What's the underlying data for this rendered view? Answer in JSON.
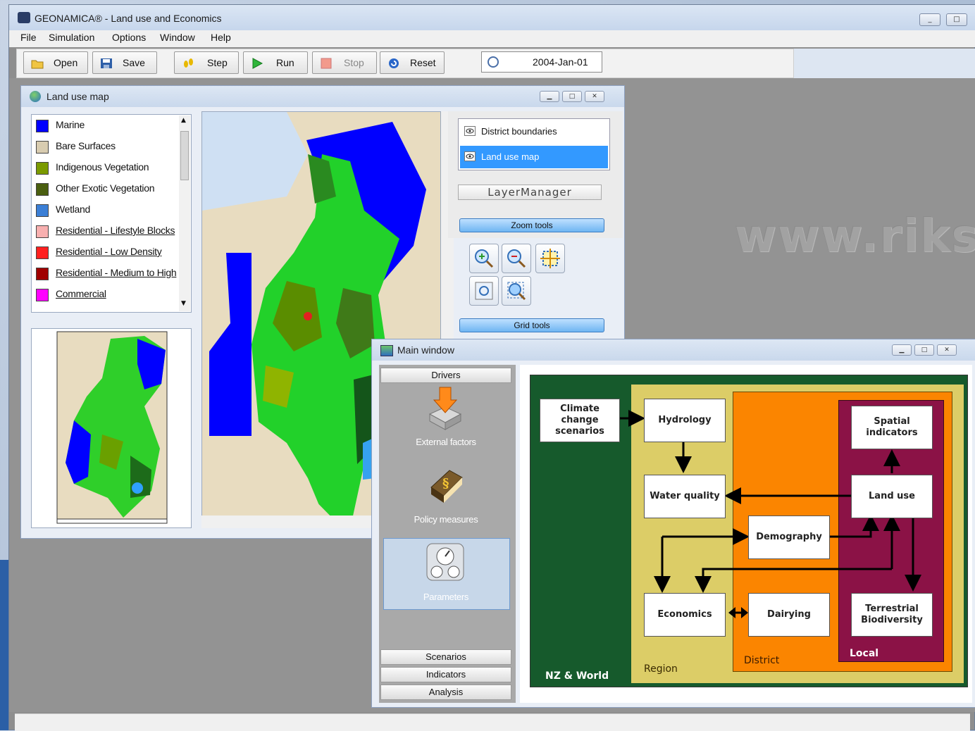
{
  "app": {
    "title": "GEONAMICA® - Land use and Economics",
    "window_controls": [
      "_",
      "□"
    ]
  },
  "menu": [
    "File",
    "Simulation",
    "Options",
    "Window",
    "Help"
  ],
  "toolbar": {
    "open": "Open",
    "save": "Save",
    "step": "Step",
    "run": "Run",
    "stop": "Stop",
    "reset": "Reset",
    "date": "2004-Jan-01"
  },
  "watermark": "www.riks.",
  "land_use_window": {
    "title": "Land use map",
    "legend": [
      {
        "label": "Marine",
        "color": "#0000ff",
        "underline": false
      },
      {
        "label": "Bare Surfaces",
        "color": "#d8ccb0",
        "underline": false
      },
      {
        "label": "Indigenous Vegetation",
        "color": "#7a9a00",
        "underline": false
      },
      {
        "label": "Other Exotic Vegetation",
        "color": "#4a5f10",
        "underline": false
      },
      {
        "label": "Wetland",
        "color": "#3b7fd6",
        "underline": false
      },
      {
        "label": "Residential - Lifestyle Blocks",
        "color": "#f8b0b0",
        "underline": true
      },
      {
        "label": "Residential - Low Density",
        "color": "#ff2020",
        "underline": true
      },
      {
        "label": "Residential - Medium to High",
        "color": "#a00000",
        "underline": true
      },
      {
        "label": "Commercial",
        "color": "#ff00ff",
        "underline": true
      }
    ],
    "layers": [
      {
        "label": "District boundaries",
        "selected": false
      },
      {
        "label": "Land use map",
        "selected": true
      }
    ],
    "layer_manager": "LayerManager",
    "zoom_tools": "Zoom tools",
    "grid_tools": "Grid tools",
    "zoom_icons": [
      "zoom-in-icon",
      "zoom-out-icon",
      "zoom-extent-icon",
      "zoom-window-icon",
      "zoom-select-icon"
    ]
  },
  "main_window": {
    "title": "Main window",
    "drivers": "Drivers",
    "nav_items": [
      {
        "label": "External factors",
        "icon": "external-factors-icon"
      },
      {
        "label": "Policy measures",
        "icon": "policy-book-icon"
      },
      {
        "label": "Parameters",
        "icon": "gauges-icon"
      }
    ],
    "bottom_buttons": [
      "Scenarios",
      "Indicators",
      "Analysis"
    ],
    "diagram": {
      "zones": [
        "NZ & World",
        "Region",
        "District",
        "Local"
      ],
      "boxes": {
        "climate": "Climate change scenarios",
        "hydrology": "Hydrology",
        "water_quality": "Water quality",
        "demography": "Demography",
        "economics": "Economics",
        "dairying": "Dairying",
        "spatial": "Spatial indicators",
        "land_use": "Land use",
        "terrestrial": "Terrestrial Biodiversity"
      },
      "zone_colors": {
        "world": "#165a2c",
        "region": "#dccd67",
        "district": "#fb8500",
        "local": "#8b1246"
      }
    }
  }
}
